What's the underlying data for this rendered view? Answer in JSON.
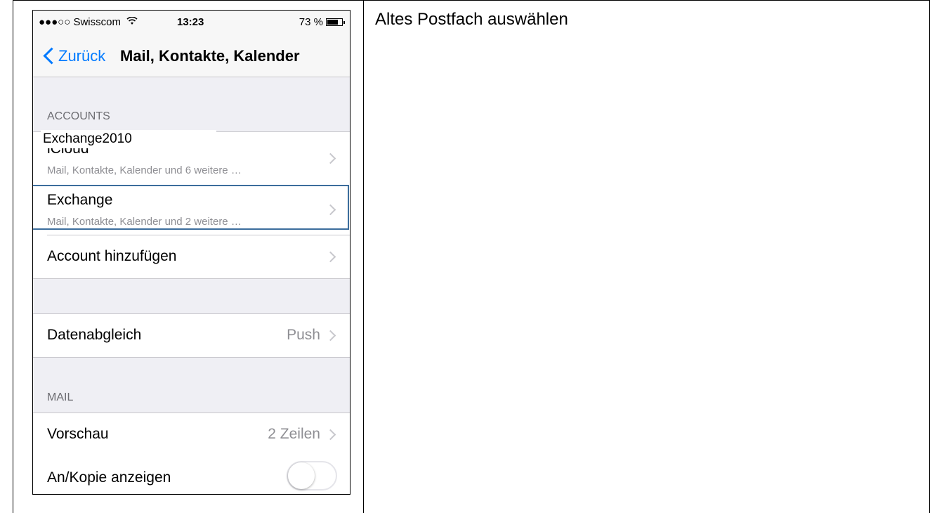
{
  "caption": "Altes Postfach auswählen",
  "status_bar": {
    "carrier": "●●●○○ Swisscom",
    "wifi_icon": "wifi-icon",
    "time": "13:23",
    "battery_percent": "73 %",
    "battery_level": 0.73
  },
  "nav": {
    "back_label": "Zurück",
    "title": "Mail, Kontakte, Kalender"
  },
  "accounts": {
    "header": "ACCOUNTS",
    "overlay_label": "Exchange2010",
    "items": [
      {
        "title": "iCloud",
        "subtitle": "Mail, Kontakte, Kalender und 6 weitere …"
      },
      {
        "title": "Exchange",
        "subtitle": "Mail, Kontakte, Kalender und 2 weitere …"
      },
      {
        "title": "Account hinzufügen"
      }
    ]
  },
  "fetch": {
    "title": "Datenabgleich",
    "value": "Push"
  },
  "mail": {
    "header": "MAIL",
    "preview_title": "Vorschau",
    "preview_value": "2 Zeilen",
    "show_to_cc_title": "An/Kopie anzeigen",
    "show_to_cc_on": false
  },
  "colors": {
    "ios_blue": "#007aff",
    "highlight_border": "#3c6d9c",
    "grouped_background": "#efeff4"
  }
}
